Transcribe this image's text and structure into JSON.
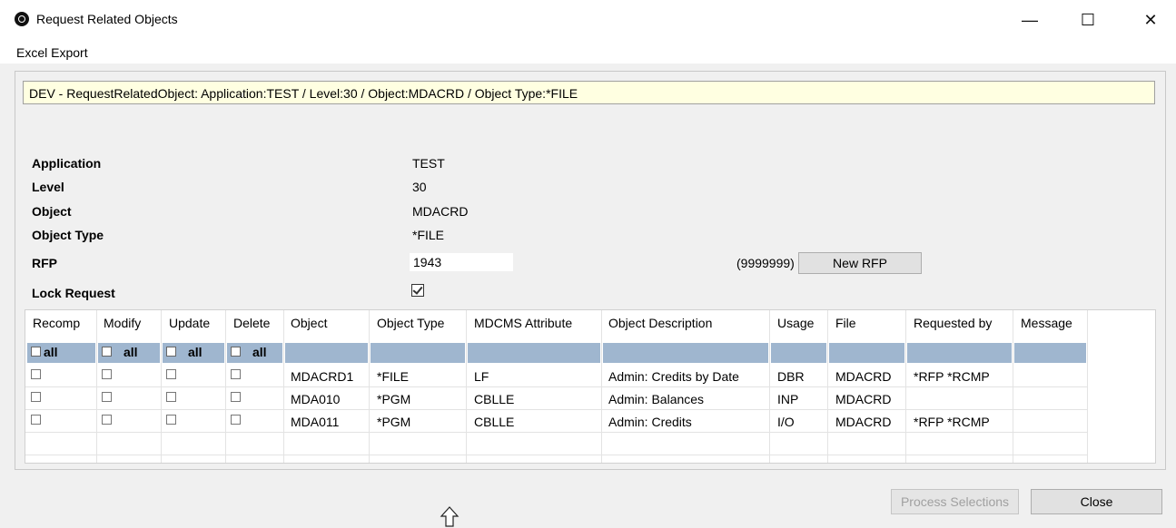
{
  "window": {
    "title": "Request Related Objects",
    "controls": {
      "minimize": "—",
      "maximize": "☐",
      "close": "✕"
    }
  },
  "menu": {
    "items": [
      "Excel Export"
    ]
  },
  "info_bar": "DEV - RequestRelatedObject: Application:TEST / Level:30 / Object:MDACRD / Object Type:*FILE",
  "fields": {
    "application": {
      "label": "Application",
      "value": "TEST"
    },
    "level": {
      "label": "Level",
      "value": "30"
    },
    "object": {
      "label": "Object",
      "value": "MDACRD"
    },
    "object_type": {
      "label": "Object Type",
      "value": "*FILE"
    },
    "rfp": {
      "label": "RFP",
      "value": "1943",
      "range": "(9999999)"
    },
    "lock_request": {
      "label": "Lock Request",
      "checked": true
    }
  },
  "buttons": {
    "new_rfp": "New RFP",
    "process_selections": "Process Selections",
    "close": "Close"
  },
  "grid": {
    "columns": [
      "Recomp",
      "Modify",
      "Update",
      "Delete",
      "Object",
      "Object Type",
      "MDCMS Attribute",
      "Object Description",
      "Usage",
      "File",
      "Requested by",
      "Message"
    ],
    "filter_all_label": "all",
    "rows": [
      {
        "object": "MDACRD1",
        "object_type": "*FILE",
        "attribute": "LF",
        "description": "Admin: Credits by Date",
        "usage": "DBR",
        "file": "MDACRD",
        "requested_by": "*RFP *RCMP",
        "message": ""
      },
      {
        "object": "MDA010",
        "object_type": "*PGM",
        "attribute": "CBLLE",
        "description": "Admin: Balances",
        "usage": "INP",
        "file": "MDACRD",
        "requested_by": "",
        "message": ""
      },
      {
        "object": "MDA011",
        "object_type": "*PGM",
        "attribute": "CBLLE",
        "description": "Admin: Credits",
        "usage": "I/O",
        "file": "MDACRD",
        "requested_by": "*RFP *RCMP",
        "message": ""
      }
    ]
  },
  "colors": {
    "info_bar_bg": "#ffffe1",
    "filter_row_bg": "#9fb6cf"
  }
}
